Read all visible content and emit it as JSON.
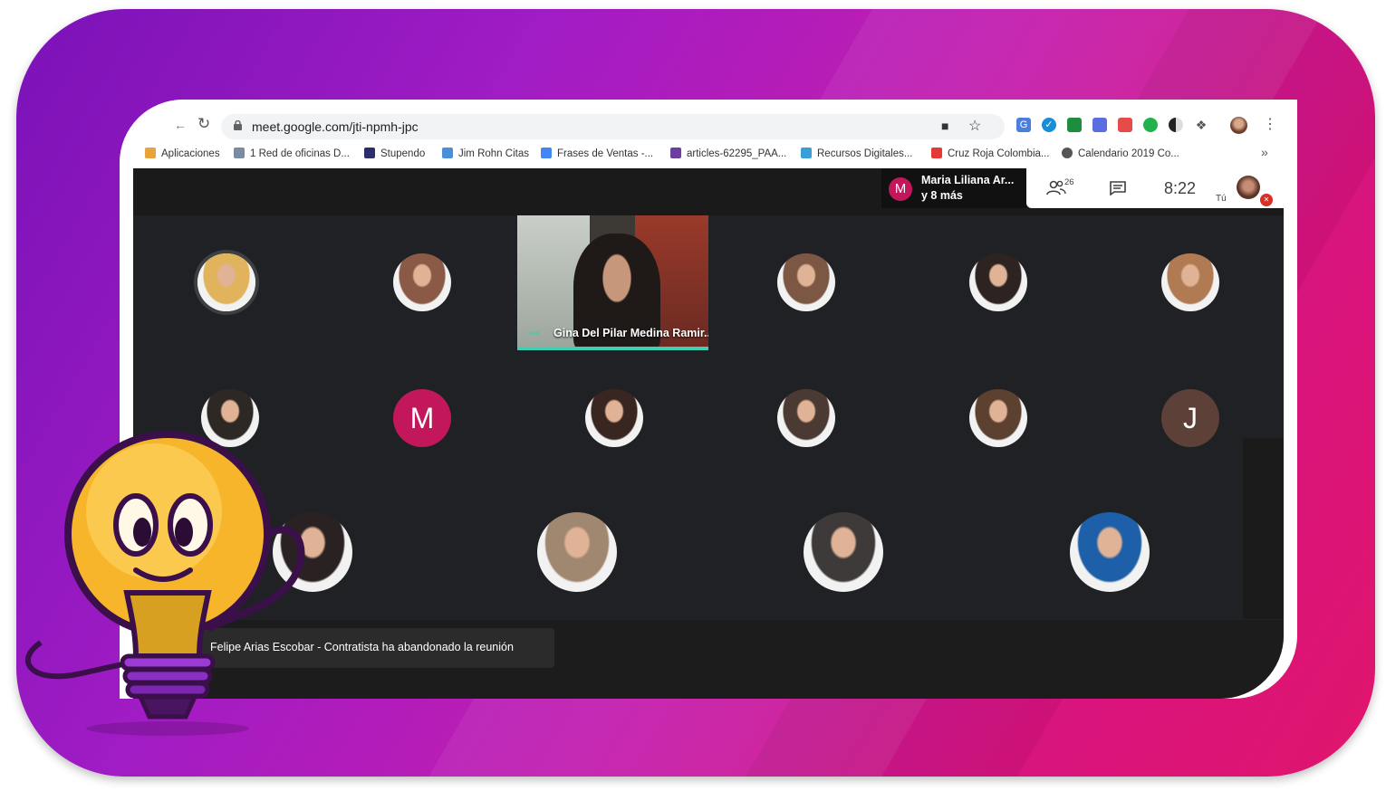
{
  "browser": {
    "url": "meet.google.com/jti-npmh-jpc",
    "bookmarks": [
      {
        "label": "Aplicaciones",
        "color": "#e8a33b"
      },
      {
        "label": "1 Red de oficinas D...",
        "color": "#7a8ca3"
      },
      {
        "label": "Stupendo",
        "color": "#2a2f6b"
      },
      {
        "label": "Jim Rohn Citas",
        "color": "#4a90d9"
      },
      {
        "label": "Frases de Ventas -...",
        "color": "#4285f4"
      },
      {
        "label": "articles-62295_PAA...",
        "color": "#6b3fa0"
      },
      {
        "label": "Recursos Digitales...",
        "color": "#3a9fd6"
      },
      {
        "label": "Cruz Roja Colombia...",
        "color": "#e53935"
      },
      {
        "label": "Calendario 2019 Co...",
        "color": "#555555"
      }
    ],
    "more_bookmarks": "»"
  },
  "meet": {
    "speaking": {
      "avatar_letter": "M",
      "name": "Maria Liliana Ar...",
      "more": "y 8 más"
    },
    "people_count": "26",
    "time": "8:22",
    "self_label": "Tú",
    "video_tile_name": "Gina Del Pilar Medina Ramir...",
    "tiles": [
      {
        "type": "photo",
        "color": "#e1b35c"
      },
      {
        "type": "photo",
        "color": "#8a5a46"
      },
      {
        "type": "photo",
        "color": "#7c5844"
      },
      {
        "type": "photo",
        "color": "#2d2320"
      },
      {
        "type": "photo",
        "color": "#b07b52"
      },
      {
        "type": "photo",
        "color": "#2e2824"
      },
      {
        "type": "letter",
        "letter": "M",
        "color": "#c2185b"
      },
      {
        "type": "photo",
        "color": "#3a2620"
      },
      {
        "type": "photo",
        "color": "#4b3a33"
      },
      {
        "type": "photo",
        "color": "#5c4030"
      },
      {
        "type": "letter",
        "letter": "J",
        "color": "#5d4037"
      },
      {
        "type": "photo",
        "color": "#2a2222"
      },
      {
        "type": "photo",
        "color": "#a08770"
      },
      {
        "type": "photo",
        "color": "#3e3a3a"
      },
      {
        "type": "photo",
        "color": "#1d5fa8"
      }
    ],
    "toast": "Felipe Arias Escobar - Contratista ha abandonado la reunión"
  },
  "colors": {
    "accent_teal": "#3ecfb2",
    "frame_start": "#7a12b8",
    "frame_end": "#e0156c"
  }
}
